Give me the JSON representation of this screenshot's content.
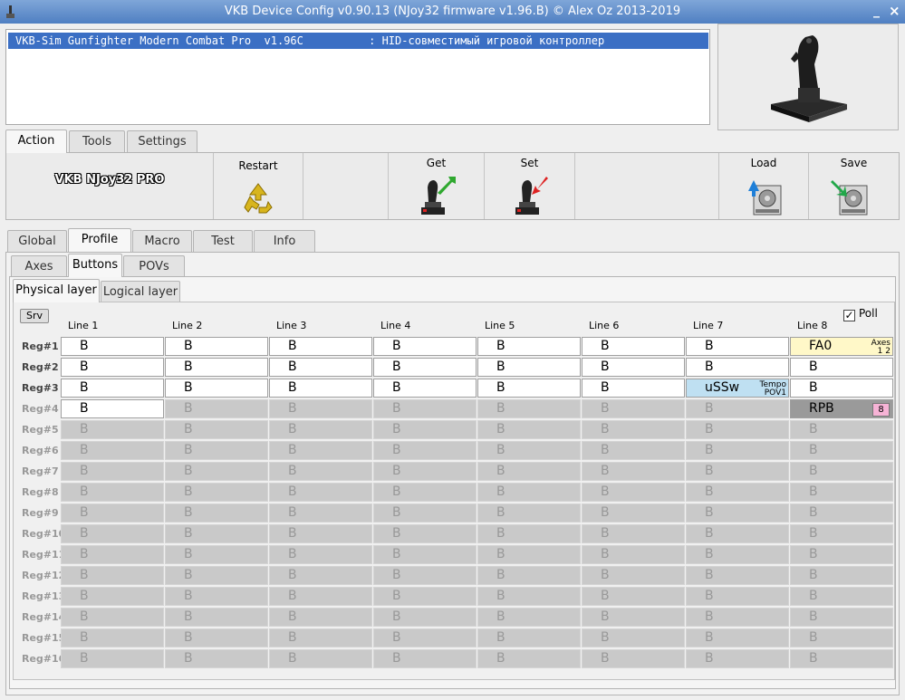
{
  "window": {
    "title": "VKB Device Config v0.90.13 (NJoy32 firmware v1.96.B) © Alex Oz 2013-2019",
    "minimize": "_",
    "close": "×"
  },
  "devices": {
    "selected": "VKB-Sim Gunfighter Modern Combat Pro  v1.96C          : HID-совместимый игровой контроллер"
  },
  "top_tabs": [
    "Action",
    "Tools",
    "Settings"
  ],
  "toolbar": {
    "brand": "VKB NJoy32 PRO",
    "restart": "Restart",
    "get": "Get",
    "set": "Set",
    "load": "Load",
    "save": "Save"
  },
  "main_tabs": [
    "Global",
    "Profile",
    "Macro",
    "Test",
    "Info"
  ],
  "sub_tabs": [
    "Axes",
    "Buttons",
    "POVs"
  ],
  "layer_tabs": [
    "Physical layer",
    "Logical layer"
  ],
  "srv_button": "Srv",
  "poll": {
    "label": "Poll",
    "checked": true,
    "mark": "✓"
  },
  "columns": [
    "Line 1",
    "Line 2",
    "Line 3",
    "Line 4",
    "Line 5",
    "Line 6",
    "Line 7",
    "Line 8"
  ],
  "rows": [
    {
      "label": "Reg#1",
      "enabled": true,
      "cells": [
        "B",
        "B",
        "B",
        "B",
        "B",
        "B",
        "B",
        "FA0"
      ]
    },
    {
      "label": "Reg#2",
      "enabled": true,
      "cells": [
        "B",
        "B",
        "B",
        "B",
        "B",
        "B",
        "B",
        "B"
      ]
    },
    {
      "label": "Reg#3",
      "enabled": true,
      "cells": [
        "B",
        "B",
        "B",
        "B",
        "B",
        "B",
        "uSSw",
        "B"
      ]
    },
    {
      "label": "Reg#4",
      "enabled": false,
      "cells": [
        "B",
        "B",
        "B",
        "B",
        "B",
        "B",
        "B",
        "RPB"
      ]
    },
    {
      "label": "Reg#5",
      "enabled": false,
      "cells": [
        "B",
        "B",
        "B",
        "B",
        "B",
        "B",
        "B",
        "B"
      ]
    },
    {
      "label": "Reg#6",
      "enabled": false,
      "cells": [
        "B",
        "B",
        "B",
        "B",
        "B",
        "B",
        "B",
        "B"
      ]
    },
    {
      "label": "Reg#7",
      "enabled": false,
      "cells": [
        "B",
        "B",
        "B",
        "B",
        "B",
        "B",
        "B",
        "B"
      ]
    },
    {
      "label": "Reg#8",
      "enabled": false,
      "cells": [
        "B",
        "B",
        "B",
        "B",
        "B",
        "B",
        "B",
        "B"
      ]
    },
    {
      "label": "Reg#9",
      "enabled": false,
      "cells": [
        "B",
        "B",
        "B",
        "B",
        "B",
        "B",
        "B",
        "B"
      ]
    },
    {
      "label": "Reg#10",
      "enabled": false,
      "cells": [
        "B",
        "B",
        "B",
        "B",
        "B",
        "B",
        "B",
        "B"
      ]
    },
    {
      "label": "Reg#11",
      "enabled": false,
      "cells": [
        "B",
        "B",
        "B",
        "B",
        "B",
        "B",
        "B",
        "B"
      ]
    },
    {
      "label": "Reg#12",
      "enabled": false,
      "cells": [
        "B",
        "B",
        "B",
        "B",
        "B",
        "B",
        "B",
        "B"
      ]
    },
    {
      "label": "Reg#13",
      "enabled": false,
      "cells": [
        "B",
        "B",
        "B",
        "B",
        "B",
        "B",
        "B",
        "B"
      ]
    },
    {
      "label": "Reg#14",
      "enabled": false,
      "cells": [
        "B",
        "B",
        "B",
        "B",
        "B",
        "B",
        "B",
        "B"
      ]
    },
    {
      "label": "Reg#15",
      "enabled": false,
      "cells": [
        "B",
        "B",
        "B",
        "B",
        "B",
        "B",
        "B",
        "B"
      ]
    },
    {
      "label": "Reg#16",
      "enabled": false,
      "cells": [
        "B",
        "B",
        "B",
        "B",
        "B",
        "B",
        "B",
        "B"
      ]
    }
  ],
  "cell_tags": {
    "fa0_tag": "Axes\n1 2",
    "ussw_tag": "Tempo\nPOV1",
    "rpb_badge": "8"
  },
  "colors": {
    "titlebar": "#5a88c8",
    "selection": "#3b6fc4",
    "fa_cell": "#fff8c8",
    "pov_cell": "#bfe0f2",
    "badge": "#f7b3d6"
  }
}
